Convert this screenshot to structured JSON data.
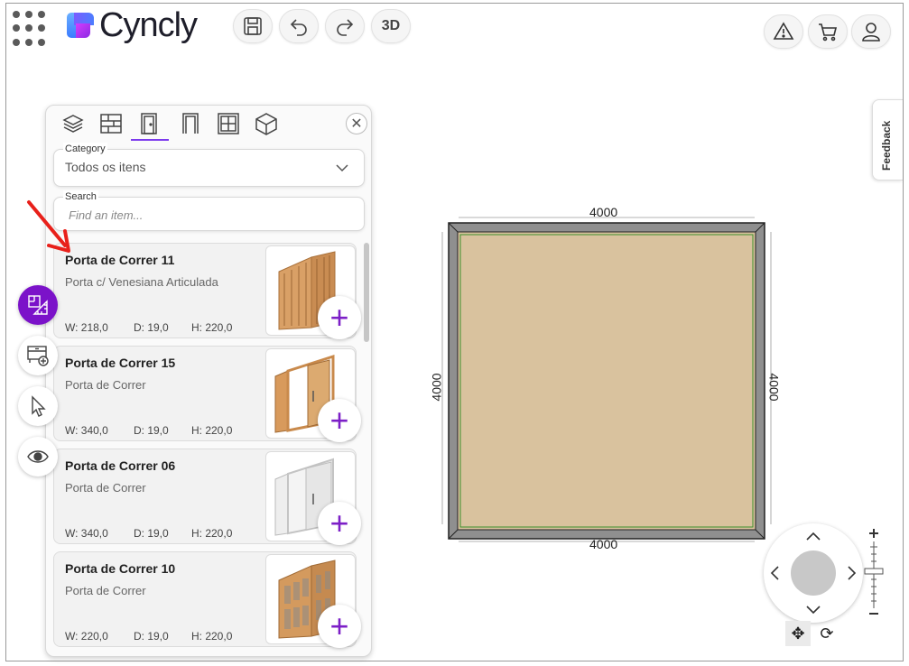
{
  "app": {
    "brand_name": "Cyncly",
    "toolbar": {
      "save_icon": "save-icon",
      "undo_icon": "undo-icon",
      "redo_icon": "redo-icon",
      "view_3d_label": "3D",
      "warning_icon": "warning-icon",
      "cart_icon": "cart-icon",
      "user_icon": "user-icon"
    }
  },
  "panel": {
    "tabs": [
      {
        "icon": "layers-icon"
      },
      {
        "icon": "wall-icon"
      },
      {
        "icon": "door-icon",
        "active": true
      },
      {
        "icon": "opening-icon"
      },
      {
        "icon": "window-icon"
      },
      {
        "icon": "cube-icon"
      }
    ],
    "category": {
      "label": "Category",
      "value": "Todos os itens"
    },
    "search": {
      "label": "Search",
      "placeholder": "Find an item..."
    },
    "items": [
      {
        "title": "Porta de Correr 11",
        "desc": "Porta c/ Venesiana Articulada",
        "w": "W: 218,0",
        "d": "D: 19,0",
        "h": "H: 220,0",
        "thumb": "wood-louver"
      },
      {
        "title": "Porta de Correr 15",
        "desc": "Porta de Correr",
        "w": "W: 340,0",
        "d": "D: 19,0",
        "h": "H: 220,0",
        "thumb": "wood-frame"
      },
      {
        "title": "Porta de Correr 06",
        "desc": "Porta de Correr",
        "w": "W: 340,0",
        "d": "D: 19,0",
        "h": "H: 220,0",
        "thumb": "white-panel"
      },
      {
        "title": "Porta de Correr 10",
        "desc": "Porta de Correr",
        "w": "W: 220,0",
        "d": "D: 19,0",
        "h": "H: 220,0",
        "thumb": "wood-louver"
      }
    ]
  },
  "feedback_label": "Feedback",
  "plan": {
    "dim_top": "4000",
    "dim_bottom": "4000",
    "dim_left": "4000",
    "dim_right": "4000",
    "floor_color": "#d9c29e",
    "wall_color": "#8f8f8f",
    "accent": "#7b12c9"
  }
}
